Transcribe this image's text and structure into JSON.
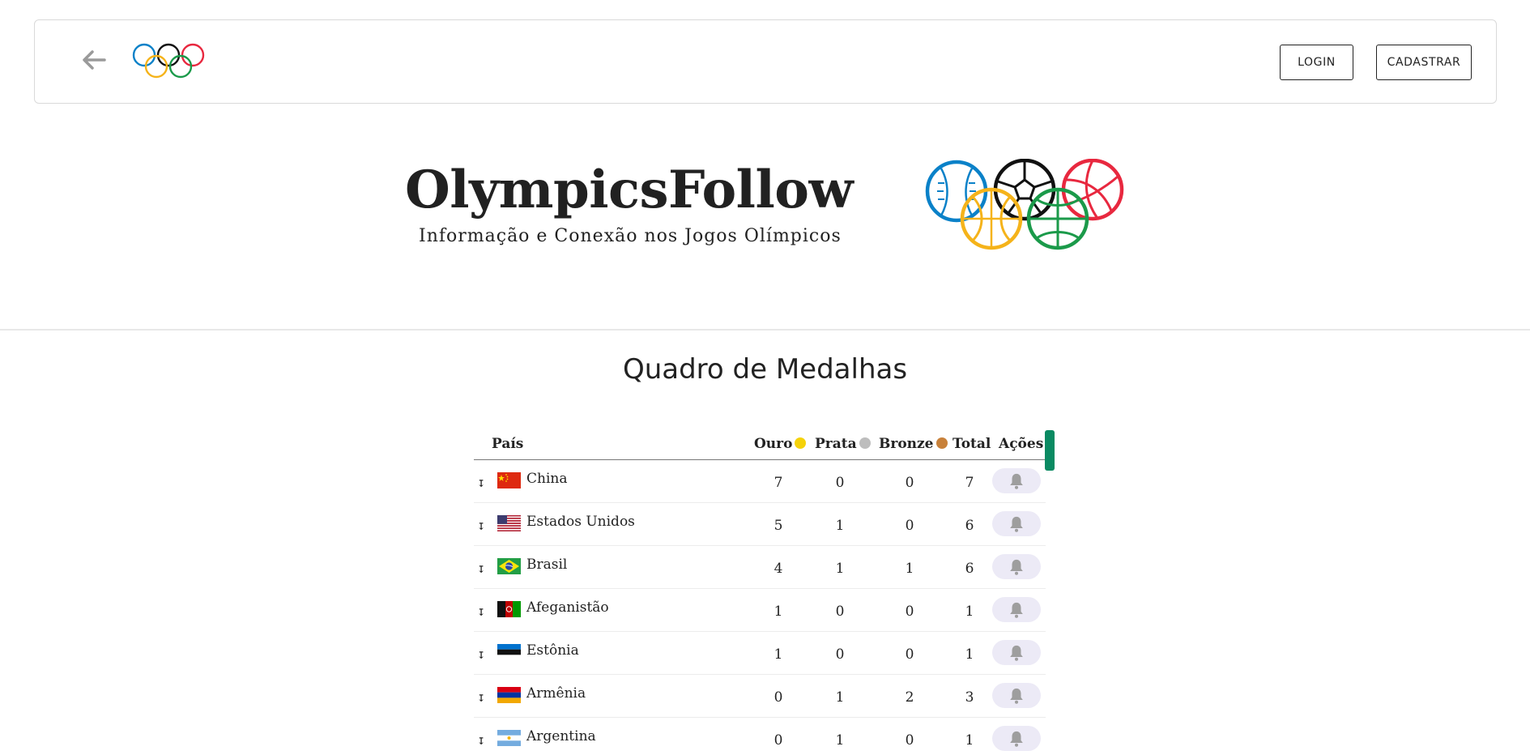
{
  "nav": {
    "login_label": "LOGIN",
    "signup_label": "CADASTRAR",
    "back_icon": "arrow-left-icon",
    "logo_icon": "olympic-rings-icon"
  },
  "hero": {
    "title": "OlympicsFollow",
    "subtitle": "Informação e Conexão nos Jogos Olímpicos",
    "logo_icon": "sport-balls-rings-icon"
  },
  "medals_section": {
    "title": "Quadro de Medalhas",
    "columns": {
      "country": "País",
      "gold": "Ouro",
      "silver": "Prata",
      "bronze": "Bronze",
      "total": "Total",
      "actions": "Ações"
    },
    "colors": {
      "gold": "#f5d20a",
      "silver": "#bdbdbd",
      "bronze": "#c8813a",
      "accent": "#0a8a62"
    },
    "rows": [
      {
        "country": "China",
        "flag": "china-flag-icon",
        "gold": "7",
        "silver": "0",
        "bronze": "0",
        "total": "7"
      },
      {
        "country": "Estados Unidos",
        "flag": "usa-flag-icon",
        "gold": "5",
        "silver": "1",
        "bronze": "0",
        "total": "6"
      },
      {
        "country": "Brasil",
        "flag": "brazil-flag-icon",
        "gold": "4",
        "silver": "1",
        "bronze": "1",
        "total": "6"
      },
      {
        "country": "Afeganistão",
        "flag": "afghanistan-flag-icon",
        "gold": "1",
        "silver": "0",
        "bronze": "0",
        "total": "1"
      },
      {
        "country": "Estônia",
        "flag": "estonia-flag-icon",
        "gold": "1",
        "silver": "0",
        "bronze": "0",
        "total": "1"
      },
      {
        "country": "Armênia",
        "flag": "armenia-flag-icon",
        "gold": "0",
        "silver": "1",
        "bronze": "2",
        "total": "3"
      },
      {
        "country": "Argentina",
        "flag": "argentina-flag-icon",
        "gold": "0",
        "silver": "1",
        "bronze": "0",
        "total": "1"
      }
    ]
  }
}
